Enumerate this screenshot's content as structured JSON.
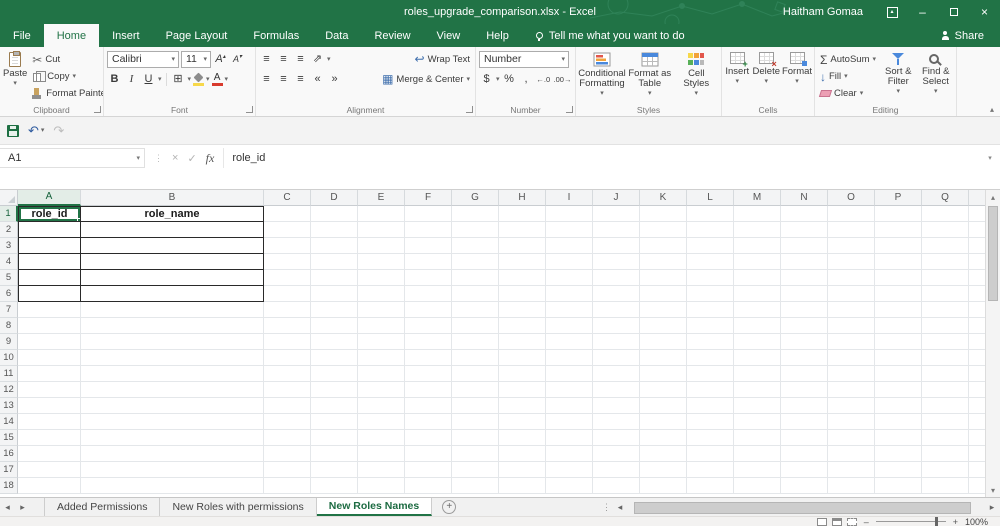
{
  "colors": {
    "excel_green": "#217346",
    "selection_border": "#217346",
    "active_sheet_text": "#1d6b42"
  },
  "titlebar": {
    "title": "roles_upgrade_comparison.xlsx - Excel",
    "user": "Haitham Gomaa"
  },
  "ribbon": {
    "tabs": [
      {
        "label": "File",
        "active": false
      },
      {
        "label": "Home",
        "active": true
      },
      {
        "label": "Insert",
        "active": false
      },
      {
        "label": "Page Layout",
        "active": false
      },
      {
        "label": "Formulas",
        "active": false
      },
      {
        "label": "Data",
        "active": false
      },
      {
        "label": "Review",
        "active": false
      },
      {
        "label": "View",
        "active": false
      },
      {
        "label": "Help",
        "active": false
      }
    ],
    "tell_me": "Tell me what you want to do",
    "share": "Share",
    "clipboard": {
      "label": "Clipboard",
      "paste": "Paste",
      "cut": "Cut",
      "copy": "Copy",
      "format_painter": "Format Painter"
    },
    "font": {
      "label": "Font",
      "family": "Calibri",
      "size": "11",
      "bold": "B",
      "italic": "I",
      "underline": "U",
      "color_letter": "A"
    },
    "alignment": {
      "label": "Alignment",
      "wrap_text": "Wrap Text",
      "merge_center": "Merge & Center"
    },
    "number": {
      "label": "Number",
      "format": "Number",
      "currency": "$",
      "percent": "%",
      "comma": ",",
      "increase_decimal": "←.0",
      "decrease_decimal": ".00→"
    },
    "styles": {
      "label": "Styles",
      "conditional": "Conditional Formatting",
      "format_table": "Format as Table",
      "cell_styles": "Cell Styles"
    },
    "cells": {
      "label": "Cells",
      "insert": "Insert",
      "delete": "Delete",
      "format": "Format"
    },
    "editing": {
      "label": "Editing",
      "autosum": "AutoSum",
      "fill": "Fill",
      "clear": "Clear",
      "sort_filter": "Sort & Filter",
      "find_select": "Find & Select"
    }
  },
  "formula_bar": {
    "name_box": "A1",
    "fx": "fx",
    "content": "role_id"
  },
  "grid": {
    "columns": [
      "A",
      "B",
      "C",
      "D",
      "E",
      "F",
      "G",
      "H",
      "I",
      "J",
      "K",
      "L",
      "M",
      "N",
      "O",
      "P",
      "Q"
    ],
    "row_count": 18,
    "cells": [
      {
        "ref": "A1",
        "col": "A",
        "row": 1,
        "text": "role_id"
      },
      {
        "ref": "B1",
        "col": "B",
        "row": 1,
        "text": "role_name"
      }
    ],
    "selection": {
      "active_cell": "A1",
      "col": "A",
      "row": 1
    },
    "table_range": {
      "cols": [
        "A",
        "B"
      ],
      "first_row": 1,
      "last_row": 6
    }
  },
  "sheet_bar": {
    "tabs": [
      {
        "label": "Added Permissions",
        "active": false
      },
      {
        "label": "New Roles with permissions",
        "active": false
      },
      {
        "label": "New Roles Names",
        "active": true
      }
    ]
  },
  "status_bar": {
    "zoom": "100%"
  },
  "icons": {
    "lightbulb-icon": "css-shape",
    "person-icon": "css-shape",
    "scissors-icon": "✂",
    "copy-icon": "css-shape",
    "format-painter-icon": "css-shape",
    "paste-icon": "css-clipboard",
    "borders-icon": "⊞",
    "fill-color-icon": "css-bucket-yellow-bar",
    "font-color-icon": "A-red-bar",
    "align-icon": "≡",
    "orientation-icon": "⇗",
    "wrap-text-icon": "↩",
    "merge-center-icon": "▦",
    "autosum-icon": "Σ",
    "fill-down-icon": "↓",
    "clear-icon": "css-eraser",
    "sort-filter-icon": "css-funnel",
    "find-select-icon": "css-magnifier",
    "save-icon": "css-floppy",
    "undo-icon": "↶",
    "redo-icon": "↷",
    "cancel-icon": "×",
    "enter-icon": "✓",
    "dropdown-icon": "▾"
  }
}
